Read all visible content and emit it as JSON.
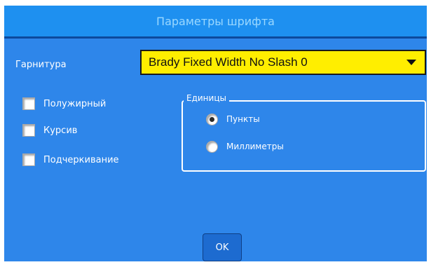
{
  "dialog": {
    "title": "Параметры шрифта"
  },
  "typeface": {
    "label": "Гарнитура",
    "value": "Brady Fixed Width No Slash 0"
  },
  "styles": [
    {
      "label": "Полужирный",
      "checked": false
    },
    {
      "label": "Курсив",
      "checked": false
    },
    {
      "label": "Подчеркивание",
      "checked": false
    }
  ],
  "units": {
    "legend": "Единицы",
    "options": [
      {
        "label": "Пункты",
        "selected": true
      },
      {
        "label": "Миллиметры",
        "selected": false
      }
    ]
  },
  "buttons": {
    "ok_label": "OK"
  },
  "colors": {
    "title_bg": "#1e90f0",
    "title_text": "#9ad8ff",
    "body_bg": "#2e86ea",
    "dropdown_bg": "#ffee00",
    "button_bg": "#1d6bd0"
  }
}
